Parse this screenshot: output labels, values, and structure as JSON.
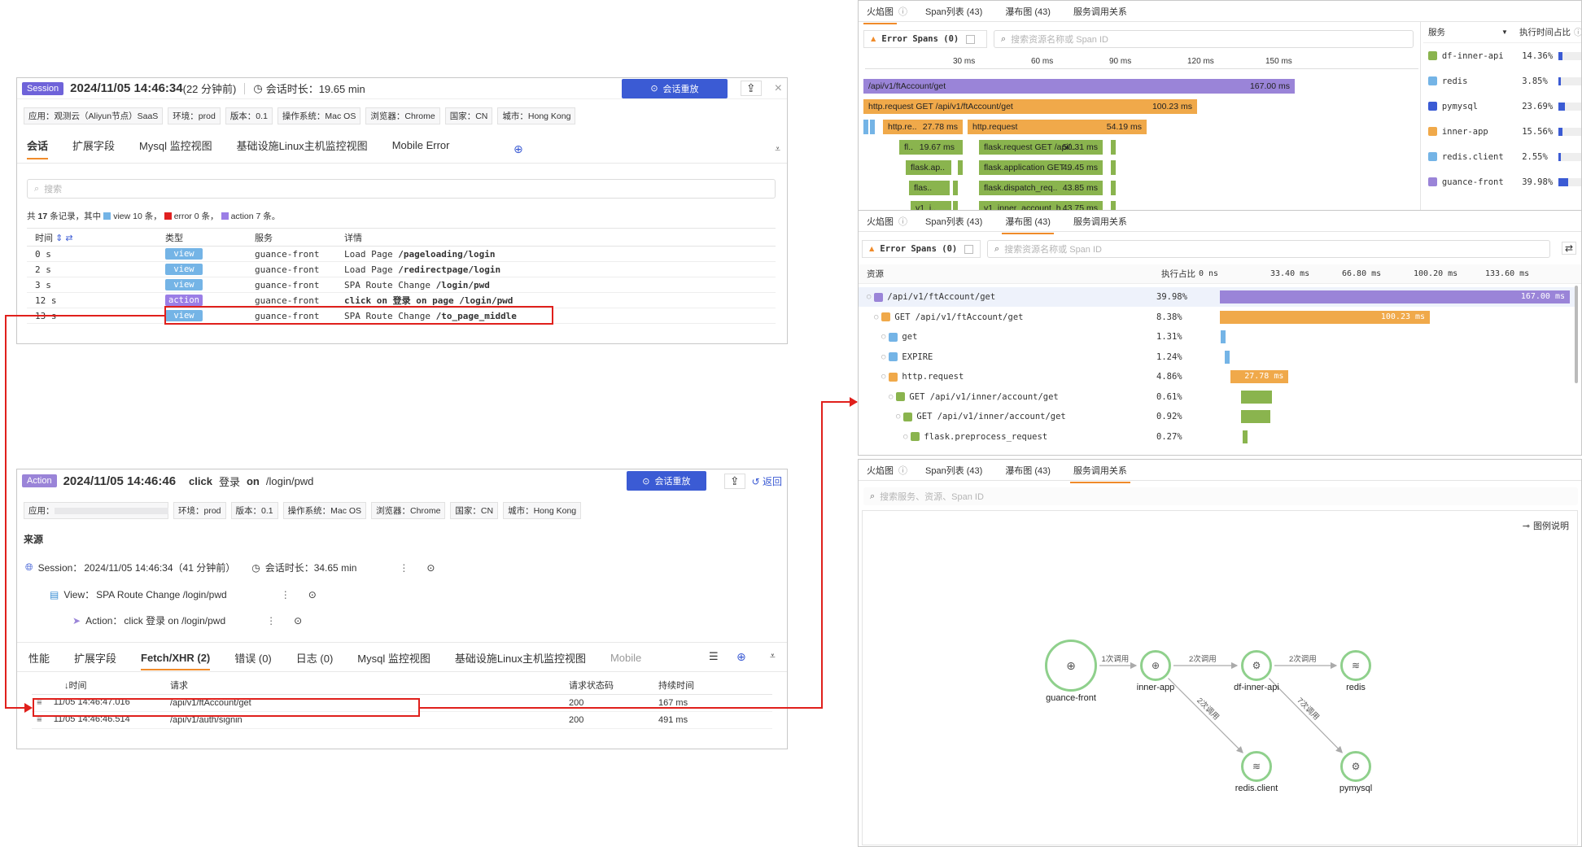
{
  "session_panel": {
    "badge": "Session",
    "datetime": "2024/11/05 14:46:34",
    "relative": "(22 分钟前)",
    "duration_label": "会话时长：19.65 min",
    "replay": "会话重放",
    "tags": [
      "应用：观测云（Aliyun节点）SaaS",
      "环境：prod",
      "版本：0.1",
      "操作系统：Mac OS",
      "浏览器：Chrome",
      "国家：CN",
      "城市：Hong Kong"
    ],
    "tabs": [
      "会话",
      "扩展字段",
      "Mysql 监控视图",
      "基础设施Linux主机监控视图",
      "Mobile Error"
    ],
    "search_placeholder": "搜索",
    "summary": {
      "p1": "共",
      "total": "17",
      "p2": "条记录，其中",
      "view": "view 10 条，",
      "error": "error 0 条，",
      "action": "action 7 条。"
    },
    "columns": [
      "时间",
      "类型",
      "服务",
      "详情"
    ],
    "rows": [
      {
        "time": "0 s",
        "type": "view",
        "service": "guance-front",
        "detail": "Load Page ",
        "bold": "/pageloading/login"
      },
      {
        "time": "2 s",
        "type": "view",
        "service": "guance-front",
        "detail": "Load Page ",
        "bold": "/redirectpage/login"
      },
      {
        "time": "3 s",
        "type": "view",
        "service": "guance-front",
        "detail": "SPA Route Change ",
        "bold": "/login/pwd"
      },
      {
        "time": "12 s",
        "type": "action",
        "service": "guance-front",
        "detail": "",
        "bold": "click on 登录 on page /login/pwd"
      },
      {
        "time": "13 s",
        "type": "view",
        "service": "guance-front",
        "detail": "SPA Route Change ",
        "bold": "/to_page_middle"
      }
    ],
    "colors": {
      "view": "#74b4e6",
      "action": "#9b7ee6",
      "error": "#e02020"
    }
  },
  "action_panel": {
    "badge": "Action",
    "datetime": "2024/11/05 14:46:46",
    "click": "click",
    "target": "登录",
    "on": "on",
    "path": "/login/pwd",
    "replay": "会话重放",
    "back": "返回",
    "app_label": "应用：",
    "tags": [
      "环境：prod",
      "版本：0.1",
      "操作系统：Mac OS",
      "浏览器：Chrome",
      "国家：CN",
      "城市：Hong Kong"
    ],
    "source_title": "来源",
    "session_line": "Session：",
    "session_value": "2024/11/05 14:46:34（41 分钟前）",
    "session_duration": "会话时长：34.65 min",
    "view_line": "View：",
    "view_value": "SPA Route Change /login/pwd",
    "action_line": "Action：",
    "action_value": "click 登录 on /login/pwd",
    "tabs": [
      "性能",
      "扩展字段",
      "Fetch/XHR (2)",
      "错误 (0)",
      "日志 (0)",
      "Mysql 监控视图",
      "基础设施Linux主机监控视图",
      "Mobile"
    ],
    "columns": [
      "时间",
      "请求",
      "请求状态码",
      "持续时间"
    ],
    "rows": [
      {
        "time": "11/05 14:46:47.016",
        "req": "/api/v1/ftAccount/get",
        "code": "200",
        "dur": "167 ms"
      },
      {
        "time": "11/05 14:46:46.514",
        "req": "/api/v1/auth/signin",
        "code": "200",
        "dur": "491 ms"
      }
    ]
  },
  "flame_panel": {
    "tabs": [
      "火焰图",
      "Span列表 (43)",
      "瀑布图 (43)",
      "服务调用关系"
    ],
    "error_spans": "Error Spans (0)",
    "search_placeholder": "搜索资源名称或 Span ID",
    "ticks": [
      "30 ms",
      "60 ms",
      "90 ms",
      "120 ms",
      "150 ms"
    ],
    "bars": [
      {
        "label": "/api/v1/ftAccount/get",
        "value": "167.00 ms",
        "color": "#9a84d8"
      },
      {
        "label": "http.request GET /api/v1/ftAccount/get",
        "value": "100.23 ms",
        "color": "#f0a94a"
      },
      {
        "label": "http.re..",
        "value": "27.78 ms",
        "color": "#f0a94a"
      },
      {
        "label": "http.request",
        "value": "54.19 ms",
        "color": "#f0a94a"
      },
      {
        "label": "fl..",
        "value": "19.67 ms",
        "color": "#8ab44e"
      },
      {
        "label": "flask.request GET /api/..",
        "value": "50.31 ms",
        "color": "#8ab44e"
      },
      {
        "label": "flask.ap..",
        "value": "",
        "color": "#8ab44e"
      },
      {
        "label": "flask.application GET ..",
        "value": "49.45 ms",
        "color": "#8ab44e"
      },
      {
        "label": "flas..",
        "value": "",
        "color": "#8ab44e"
      },
      {
        "label": "flask.dispatch_req..",
        "value": "43.85 ms",
        "color": "#8ab44e"
      },
      {
        "label": "v1_i..",
        "value": "",
        "color": "#8ab44e"
      },
      {
        "label": "v1_inner_account_h..",
        "value": "43.75 ms",
        "color": "#8ab44e"
      }
    ],
    "service_header": "服务",
    "ratio_header": "执行时间占比",
    "services": [
      {
        "name": "df-inner-api",
        "pct": "14.36%",
        "frac": 0.14,
        "color": "#8ab44e"
      },
      {
        "name": "redis",
        "pct": "3.85%",
        "frac": 0.04,
        "color": "#74b4e6"
      },
      {
        "name": "pymysql",
        "pct": "23.69%",
        "frac": 0.24,
        "color": "#3b5bd4"
      },
      {
        "name": "inner-app",
        "pct": "15.56%",
        "frac": 0.16,
        "color": "#f0a94a"
      },
      {
        "name": "redis.client",
        "pct": "2.55%",
        "frac": 0.03,
        "color": "#74b4e6"
      },
      {
        "name": "guance-front",
        "pct": "39.98%",
        "frac": 0.4,
        "color": "#9a84d8"
      }
    ]
  },
  "waterfall_panel": {
    "tabs": [
      "火焰图",
      "Span列表 (43)",
      "瀑布图 (43)",
      "服务调用关系"
    ],
    "error_spans": "Error Spans (0)",
    "search_placeholder": "搜索资源名称或 Span ID",
    "col_resource": "资源",
    "col_ratio": "执行占比",
    "ticks": [
      "0 ns",
      "33.40 ms",
      "66.80 ms",
      "100.20 ms",
      "133.60 ms"
    ],
    "rows": [
      {
        "name": "/api/v1/ftAccount/get",
        "pct": "39.98%",
        "start": 0,
        "dur": 167.0,
        "label": "167.00 ms",
        "color": "#9a84d8",
        "indent": 0
      },
      {
        "name": "GET /api/v1/ftAccount/get",
        "pct": "8.38%",
        "start": 0,
        "dur": 100.23,
        "label": "100.23 ms",
        "color": "#f0a94a",
        "indent": 1
      },
      {
        "name": "get",
        "pct": "1.31%",
        "start": 0.5,
        "dur": 2.0,
        "label": "",
        "color": "#74b4e6",
        "indent": 2
      },
      {
        "name": "EXPIRE",
        "pct": "1.24%",
        "start": 2.5,
        "dur": 2.0,
        "label": "",
        "color": "#74b4e6",
        "indent": 2
      },
      {
        "name": "http.request",
        "pct": "4.86%",
        "start": 5,
        "dur": 27.78,
        "label": "27.78 ms",
        "color": "#f0a94a",
        "indent": 2
      },
      {
        "name": "GET /api/v1/inner/account/get",
        "pct": "0.61%",
        "start": 10,
        "dur": 15,
        "label": "",
        "color": "#8ab44e",
        "indent": 3
      },
      {
        "name": "GET /api/v1/inner/account/get",
        "pct": "0.92%",
        "start": 10,
        "dur": 14,
        "label": "",
        "color": "#8ab44e",
        "indent": 4
      },
      {
        "name": "flask.preprocess_request",
        "pct": "0.27%",
        "start": 11,
        "dur": 2,
        "label": "",
        "color": "#8ab44e",
        "indent": 5
      }
    ],
    "axis_max": 167
  },
  "graph_panel": {
    "tabs": [
      "火焰图",
      "Span列表 (43)",
      "瀑布图 (43)",
      "服务调用关系"
    ],
    "search_placeholder": "搜索服务、资源、Span ID",
    "legend": "图例说明",
    "nodes": [
      {
        "id": "guance-front",
        "label": "guance-front",
        "icon": "globe-icon"
      },
      {
        "id": "inner-app",
        "label": "inner-app",
        "icon": "globe-icon"
      },
      {
        "id": "df-inner-api",
        "label": "df-inner-api",
        "icon": "network-icon"
      },
      {
        "id": "redis",
        "label": "redis",
        "icon": "layers-icon"
      },
      {
        "id": "redis.client",
        "label": "redis.client",
        "icon": "layers-icon"
      },
      {
        "id": "pymysql",
        "label": "pymysql",
        "icon": "network-icon"
      }
    ],
    "edges": [
      {
        "from": "guance-front",
        "to": "inner-app",
        "label": "1次调用"
      },
      {
        "from": "inner-app",
        "to": "df-inner-api",
        "label": "2次调用"
      },
      {
        "from": "df-inner-api",
        "to": "redis",
        "label": "2次调用"
      },
      {
        "from": "inner-app",
        "to": "redis.client",
        "label": "2次调用"
      },
      {
        "from": "df-inner-api",
        "to": "pymysql",
        "label": "7次调用"
      }
    ]
  }
}
